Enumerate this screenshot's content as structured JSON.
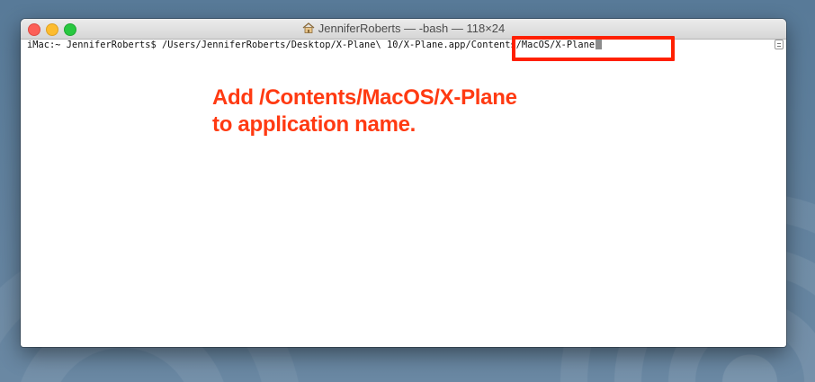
{
  "window": {
    "title": "JenniferRoberts — -bash — 118×24",
    "title_icon": "home-icon"
  },
  "terminal": {
    "prompt": "iMac:~ JenniferRoberts$ ",
    "command": "/Users/JenniferRoberts/Desktop/X-Plane\\ 10/X-Plane.app/Contents/MacOS/X-Plane",
    "highlighted_part": "/Contents/MacOS/X-Plane",
    "cursor": "block"
  },
  "annotation": {
    "line1": "Add /Contents/MacOS/X-Plane",
    "line2": "to application name."
  },
  "colors": {
    "annotation": "#ff3a12",
    "highlight_box": "#ff2000",
    "close": "#fc5f57",
    "minimize": "#fdbc2e",
    "maximize": "#28c840"
  }
}
